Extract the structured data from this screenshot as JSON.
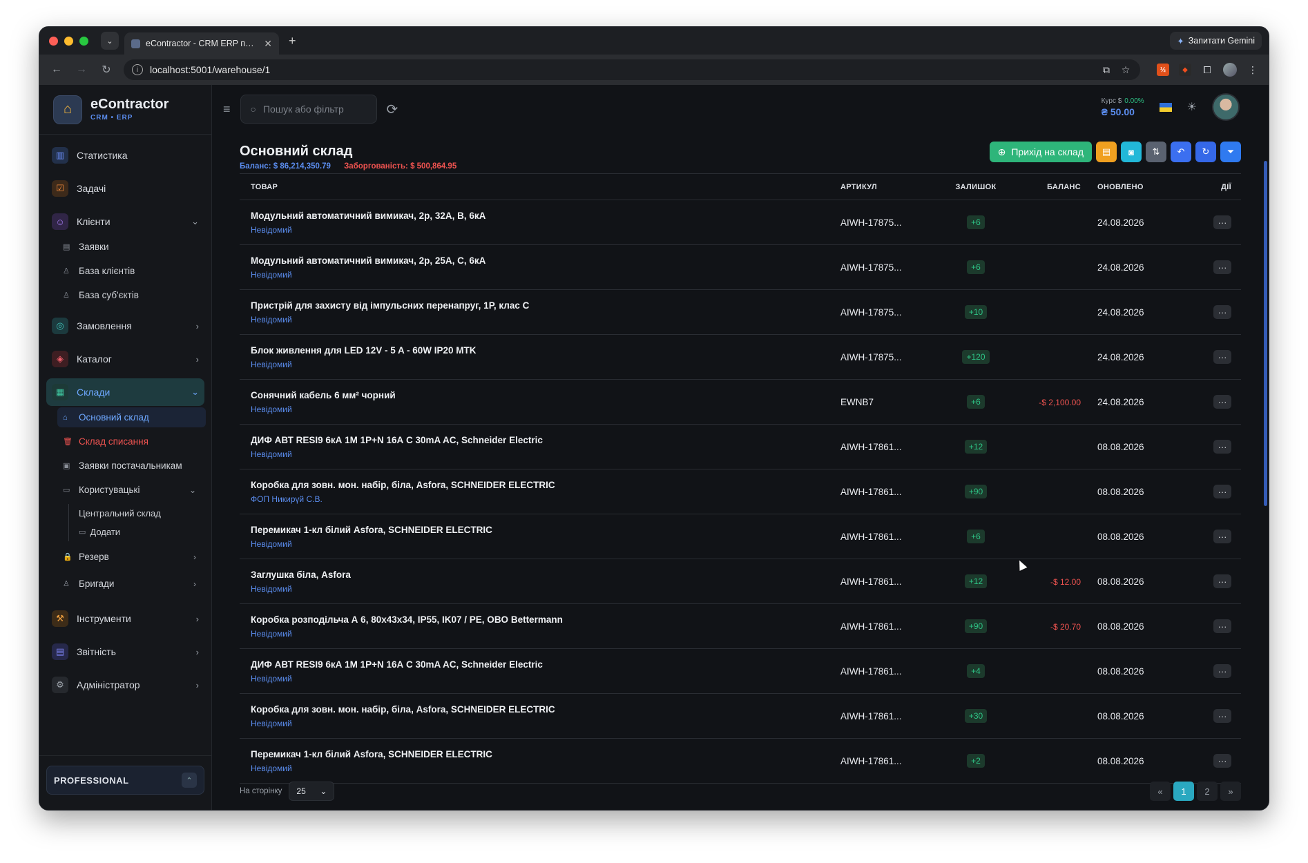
{
  "browser": {
    "tab_title": "eContractor - CRM ERP плат",
    "url": "localhost:5001/warehouse/1",
    "gemini_label": "Запитати Gemini"
  },
  "brand": {
    "name": "eContractor",
    "subtitle": "CRM • ERP"
  },
  "sidebar": {
    "items": [
      {
        "label": "Статистика",
        "icon": "chart-icon"
      },
      {
        "label": "Задачі",
        "icon": "tasks-icon"
      },
      {
        "label": "Клієнти",
        "icon": "users-icon"
      },
      {
        "label": "Замовлення",
        "icon": "orders-icon"
      },
      {
        "label": "Каталог",
        "icon": "catalog-icon"
      },
      {
        "label": "Склади",
        "icon": "warehouse-icon"
      },
      {
        "label": "Інструменти",
        "icon": "tools-icon"
      },
      {
        "label": "Звітність",
        "icon": "report-icon"
      },
      {
        "label": "Адміністратор",
        "icon": "admin-icon"
      }
    ],
    "clients_sub": [
      "Заявки",
      "База клієнтів",
      "База суб'єктів"
    ],
    "warehouse_sub": {
      "main": "Основний склад",
      "writeoff": "Склад списання",
      "supplier_requests": "Заявки постачальникам",
      "user_wh": "Користувацькі",
      "central": "Центральний склад",
      "add": "Додати",
      "reserve": "Резерв",
      "brigades": "Бригади"
    },
    "plan": "PROFESSIONAL"
  },
  "topbar": {
    "search_placeholder": "Пошук або фільтр",
    "rate_label": "Курс $",
    "rate_change": "0.00%",
    "rate_value": "₴ 50.00"
  },
  "page": {
    "title": "Основний склад",
    "balance": "Баланс: $ 86,214,350.79",
    "debt": "Заборгованість: $ 500,864.95",
    "primary_action": "Прихід на склад"
  },
  "table": {
    "headers": {
      "product": "ТОВАР",
      "sku": "АРТИКУЛ",
      "stock": "ЗАЛИШОК",
      "balance": "БАЛАНС",
      "updated": "ОНОВЛЕНО",
      "actions": "ДІЇ"
    },
    "rows": [
      {
        "name": "Модульний автоматичний вимикач, 2р, 32А, В, 6кА",
        "supplier": "Невідомий",
        "sku": "AIWH-17875...",
        "stock": "+6",
        "balance": "",
        "updated": "24.08.2026"
      },
      {
        "name": "Модульний автоматичний вимикач, 2р, 25А, С, 6кА",
        "supplier": "Невідомий",
        "sku": "AIWH-17875...",
        "stock": "+6",
        "balance": "",
        "updated": "24.08.2026"
      },
      {
        "name": "Пристрій для захисту від імпульсних перенапруг, 1Р, клас С",
        "supplier": "Невідомий",
        "sku": "AIWH-17875...",
        "stock": "+10",
        "balance": "",
        "updated": "24.08.2026"
      },
      {
        "name": "Блок живлення для LED 12V - 5 A - 60W IP20 MTK",
        "supplier": "Невідомий",
        "sku": "AIWH-17875...",
        "stock": "+120",
        "balance": "",
        "updated": "24.08.2026"
      },
      {
        "name": "Сонячний кабель 6 мм² чорний",
        "supplier": "Невідомий",
        "sku": "EWNB7",
        "stock": "+6",
        "balance": "-$ 2,100.00",
        "updated": "24.08.2026"
      },
      {
        "name": "ДИФ АВТ RESI9 6кА 1М 1P+N 16А С 30mA AC, Schneider Electric",
        "supplier": "Невідомий",
        "sku": "AIWH-17861...",
        "stock": "+12",
        "balance": "",
        "updated": "08.08.2026"
      },
      {
        "name": "Коробка для зовн. мон. набір, біла, Asfora, SCHNEIDER ELECTRIC",
        "supplier": "ФОП Никирүй С.В.",
        "sku": "AIWH-17861...",
        "stock": "+90",
        "balance": "",
        "updated": "08.08.2026"
      },
      {
        "name": "Перемикач 1-кл білий Asfora, SCHNEIDER ELECTRIC",
        "supplier": "Невідомий",
        "sku": "AIWH-17861...",
        "stock": "+6",
        "balance": "",
        "updated": "08.08.2026"
      },
      {
        "name": "Заглушка біла, Asfora",
        "supplier": "Невідомий",
        "sku": "AIWH-17861...",
        "stock": "+12",
        "balance": "-$ 12.00",
        "updated": "08.08.2026"
      },
      {
        "name": "Коробка розподільча А 6, 80х43х34, IP55, IK07 / PE, OBO Bettermann",
        "supplier": "Невідомий",
        "sku": "AIWH-17861...",
        "stock": "+90",
        "balance": "-$ 20.70",
        "updated": "08.08.2026"
      },
      {
        "name": "ДИФ АВТ RESI9 6кА 1М 1P+N 16А С 30mA AC, Schneider Electric",
        "supplier": "Невідомий",
        "sku": "AIWH-17861...",
        "stock": "+4",
        "balance": "",
        "updated": "08.08.2026"
      },
      {
        "name": "Коробка для зовн. мон. набір, біла, Asfora, SCHNEIDER ELECTRIC",
        "supplier": "Невідомий",
        "sku": "AIWH-17861...",
        "stock": "+30",
        "balance": "",
        "updated": "08.08.2026"
      },
      {
        "name": "Перемикач 1-кл білий Asfora, SCHNEIDER ELECTRIC",
        "supplier": "Невідомий",
        "sku": "AIWH-17861...",
        "stock": "+2",
        "balance": "",
        "updated": "08.08.2026"
      }
    ]
  },
  "footer": {
    "per_page_label": "На сторінку",
    "per_page_value": "25",
    "pages": [
      "«",
      "1",
      "2",
      "»"
    ]
  }
}
